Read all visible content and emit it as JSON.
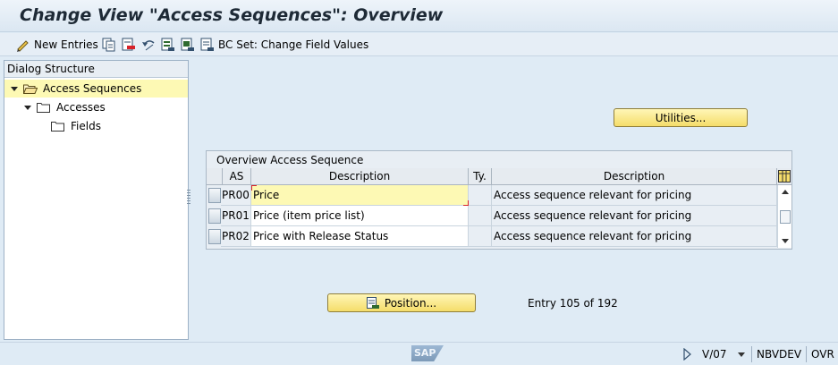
{
  "window": {
    "title": "Change View \"Access Sequences\": Overview"
  },
  "toolbar": {
    "new_entries_label": "New Entries",
    "bc_set_label": "BC Set: Change Field Values",
    "icons": [
      "pencil-icon",
      "copy-icon",
      "delete-icon",
      "undo-icon",
      "select-all-icon",
      "select-block-icon",
      "deselect-icon",
      "bc-set-icon"
    ]
  },
  "dialog_structure": {
    "header": "Dialog Structure",
    "items": [
      {
        "label": "Access Sequences",
        "level": 0,
        "expanded": true,
        "selected": true
      },
      {
        "label": "Accesses",
        "level": 1,
        "expanded": true,
        "selected": false
      },
      {
        "label": "Fields",
        "level": 2,
        "expanded": false,
        "selected": false
      }
    ]
  },
  "utilities_button": {
    "label": "Utilities..."
  },
  "table": {
    "title": "Overview Access Sequence",
    "columns": [
      "AS",
      "Description",
      "Ty.",
      "Description"
    ],
    "rows": [
      {
        "as": "PR00",
        "description": "Price",
        "type": "",
        "description2": "Access sequence relevant for pricing"
      },
      {
        "as": "PR01",
        "description": "Price (item price list)",
        "type": "",
        "description2": "Access sequence relevant for pricing"
      },
      {
        "as": "PR02",
        "description": "Price with Release Status",
        "type": "",
        "description2": "Access sequence relevant for pricing"
      }
    ]
  },
  "position_button": {
    "label": "Position..."
  },
  "entry_info": "Entry 105 of 192",
  "status_bar": {
    "logo_text": "SAP",
    "transaction": "V/07",
    "system": "NBVDEV",
    "mode": "OVR"
  },
  "colors": {
    "accent_button": "#f5dd6a",
    "selection": "#fdf9b4",
    "background": "#dfebf5"
  }
}
